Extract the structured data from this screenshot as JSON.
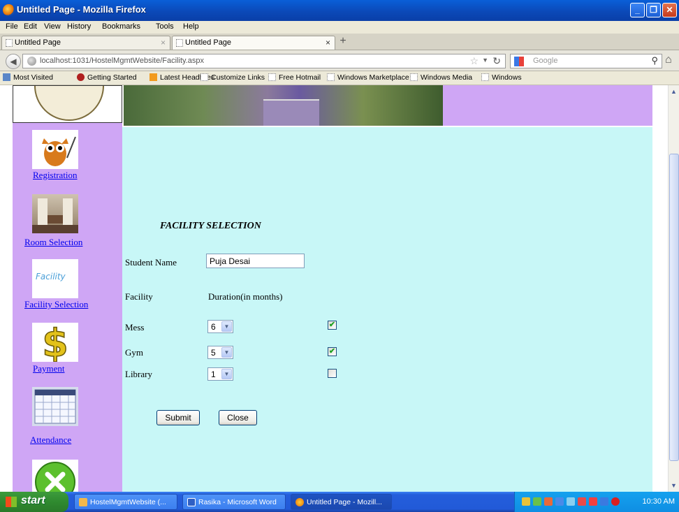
{
  "window": {
    "title": "Untitled Page - Mozilla Firefox"
  },
  "menu": [
    "File",
    "Edit",
    "View",
    "History",
    "Bookmarks",
    "Tools",
    "Help"
  ],
  "tabs": [
    {
      "label": "Untitled Page"
    },
    {
      "label": "Untitled Page"
    }
  ],
  "nav": {
    "url": "localhost:1031/HostelMgmtWebsite/Facility.aspx",
    "search_placeholder": "Google"
  },
  "bookmarks": [
    "Most Visited",
    "Getting Started",
    "Latest Headlines",
    "Customize Links",
    "Free Hotmail",
    "Windows Marketplace",
    "Windows Media",
    "Windows"
  ],
  "sidebar": {
    "links": [
      {
        "label": "Registration",
        "icon": "owl-icon"
      },
      {
        "label": "Room Selection",
        "icon": "room-icon"
      },
      {
        "label": "Facility Selection",
        "icon": "facility-icon",
        "icon_text": "Facility"
      },
      {
        "label": "Payment",
        "icon": "dollar-icon"
      },
      {
        "label": "Attendance",
        "icon": "calendar-icon"
      },
      {
        "label": "",
        "icon": "exit-icon"
      }
    ]
  },
  "form": {
    "heading": "FACILITY SELECTION",
    "student_name_label": "Student Name",
    "student_name_value": "Puja Desai",
    "facility_header": "Facility",
    "duration_header": "Duration(in months)",
    "rows": [
      {
        "name": "Mess",
        "duration": "6",
        "checked": true
      },
      {
        "name": "Gym",
        "duration": "5",
        "checked": true
      },
      {
        "name": "Library",
        "duration": "1",
        "checked": false
      }
    ],
    "submit_label": "Submit",
    "close_label": "Close"
  },
  "taskbar": {
    "start_label": "start",
    "items": [
      {
        "label": "HostelMgmtWebsite (..."
      },
      {
        "label": "Rasika - Microsoft Word"
      },
      {
        "label": "Untitled Page - Mozill..."
      }
    ],
    "clock": "10:30 AM"
  }
}
